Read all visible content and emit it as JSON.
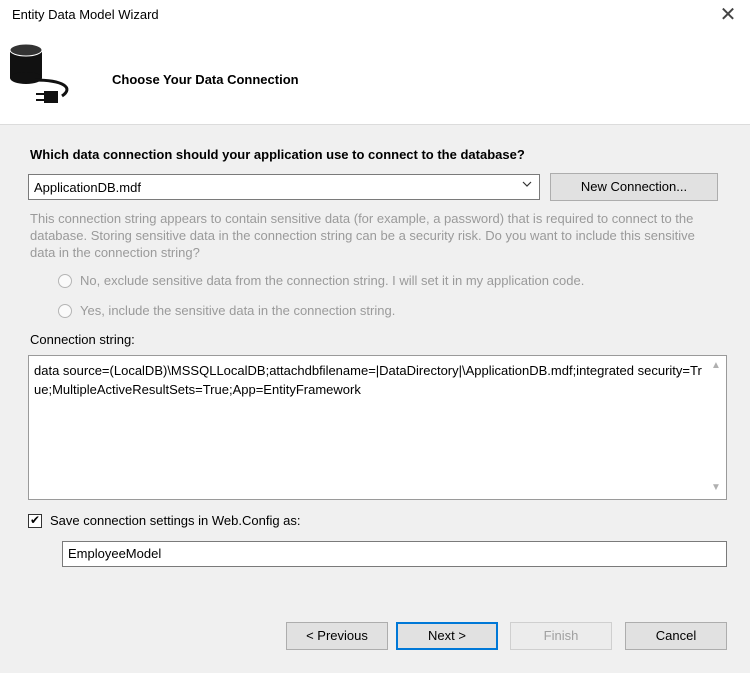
{
  "window": {
    "title": "Entity Data Model Wizard",
    "close_glyph": "✕"
  },
  "header": {
    "title": "Choose Your Data Connection",
    "icon": "database-plug-icon"
  },
  "question": "Which data connection should your application use to connect to the database?",
  "connection_select": {
    "value": "ApplicationDB.mdf"
  },
  "new_connection_label": "New Connection...",
  "warning": "This connection string appears to contain sensitive data (for example, a password) that is required to connect to the database. Storing sensitive data in the connection string can be a security risk. Do you want to include this sensitive data in the connection string?",
  "radios": [
    {
      "label": "No, exclude sensitive data from the connection string. I will set it in my application code.",
      "checked": false
    },
    {
      "label": "Yes, include the sensitive data in the connection string.",
      "checked": false
    }
  ],
  "connection_string": {
    "label": "Connection string:",
    "value": "data source=(LocalDB)\\MSSQLLocalDB;attachdbfilename=|DataDirectory|\\ApplicationDB.mdf;integrated security=True;MultipleActiveResultSets=True;App=EntityFramework"
  },
  "save_settings": {
    "label": "Save connection settings in Web.Config as:",
    "checked": true
  },
  "model_name": "EmployeeModel",
  "buttons": {
    "previous": "< Previous",
    "next": "Next >",
    "finish": "Finish",
    "cancel": "Cancel"
  },
  "colors": {
    "accent": "#0078d7",
    "disabled_text": "#9a9a9a"
  }
}
